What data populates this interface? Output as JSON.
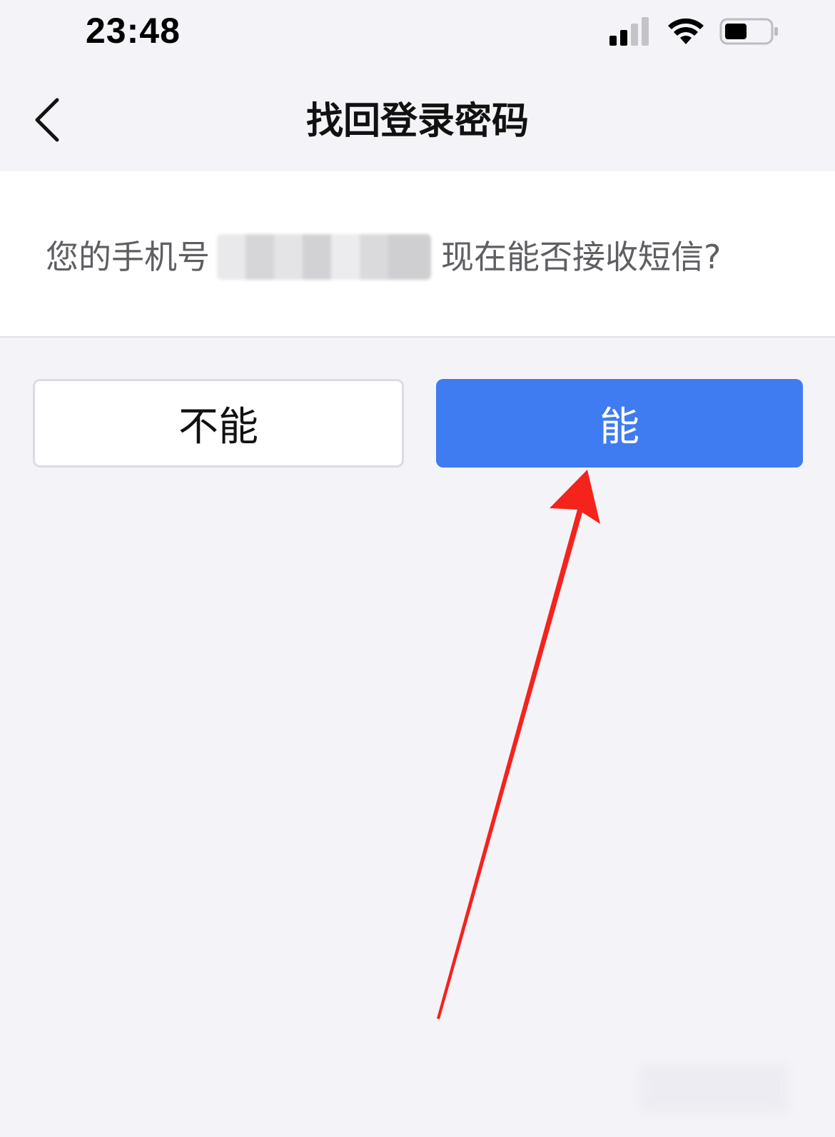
{
  "status_bar": {
    "time": "23:48",
    "signal_icon": "cellular-signal-icon",
    "wifi_icon": "wifi-icon",
    "battery_icon": "battery-icon"
  },
  "nav": {
    "back_icon": "chevron-left-icon",
    "title": "找回登录密码"
  },
  "question": {
    "prefix": "您的手机号",
    "suffix": "现在能否接收短信?"
  },
  "buttons": {
    "no_label": "不能",
    "yes_label": "能"
  },
  "colors": {
    "primary": "#3f7bf1",
    "background": "#f4f3f8",
    "annotation": "#f4231c"
  }
}
